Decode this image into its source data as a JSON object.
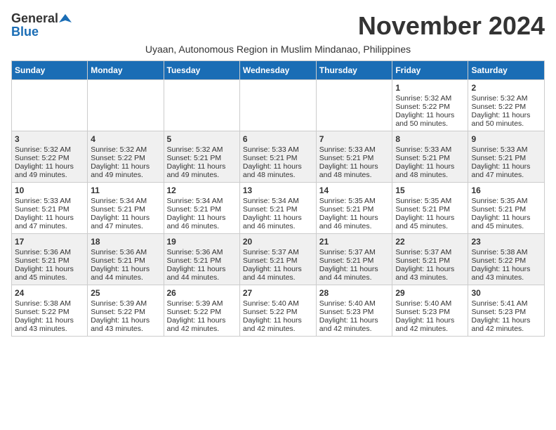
{
  "header": {
    "logo_general": "General",
    "logo_blue": "Blue",
    "month_title": "November 2024",
    "subtitle": "Uyaan, Autonomous Region in Muslim Mindanao, Philippines"
  },
  "weekdays": [
    "Sunday",
    "Monday",
    "Tuesday",
    "Wednesday",
    "Thursday",
    "Friday",
    "Saturday"
  ],
  "weeks": [
    [
      {
        "day": "",
        "sunrise": "",
        "sunset": "",
        "daylight": ""
      },
      {
        "day": "",
        "sunrise": "",
        "sunset": "",
        "daylight": ""
      },
      {
        "day": "",
        "sunrise": "",
        "sunset": "",
        "daylight": ""
      },
      {
        "day": "",
        "sunrise": "",
        "sunset": "",
        "daylight": ""
      },
      {
        "day": "",
        "sunrise": "",
        "sunset": "",
        "daylight": ""
      },
      {
        "day": "1",
        "sunrise": "Sunrise: 5:32 AM",
        "sunset": "Sunset: 5:22 PM",
        "daylight": "Daylight: 11 hours and 50 minutes."
      },
      {
        "day": "2",
        "sunrise": "Sunrise: 5:32 AM",
        "sunset": "Sunset: 5:22 PM",
        "daylight": "Daylight: 11 hours and 50 minutes."
      }
    ],
    [
      {
        "day": "3",
        "sunrise": "Sunrise: 5:32 AM",
        "sunset": "Sunset: 5:22 PM",
        "daylight": "Daylight: 11 hours and 49 minutes."
      },
      {
        "day": "4",
        "sunrise": "Sunrise: 5:32 AM",
        "sunset": "Sunset: 5:22 PM",
        "daylight": "Daylight: 11 hours and 49 minutes."
      },
      {
        "day": "5",
        "sunrise": "Sunrise: 5:32 AM",
        "sunset": "Sunset: 5:21 PM",
        "daylight": "Daylight: 11 hours and 49 minutes."
      },
      {
        "day": "6",
        "sunrise": "Sunrise: 5:33 AM",
        "sunset": "Sunset: 5:21 PM",
        "daylight": "Daylight: 11 hours and 48 minutes."
      },
      {
        "day": "7",
        "sunrise": "Sunrise: 5:33 AM",
        "sunset": "Sunset: 5:21 PM",
        "daylight": "Daylight: 11 hours and 48 minutes."
      },
      {
        "day": "8",
        "sunrise": "Sunrise: 5:33 AM",
        "sunset": "Sunset: 5:21 PM",
        "daylight": "Daylight: 11 hours and 48 minutes."
      },
      {
        "day": "9",
        "sunrise": "Sunrise: 5:33 AM",
        "sunset": "Sunset: 5:21 PM",
        "daylight": "Daylight: 11 hours and 47 minutes."
      }
    ],
    [
      {
        "day": "10",
        "sunrise": "Sunrise: 5:33 AM",
        "sunset": "Sunset: 5:21 PM",
        "daylight": "Daylight: 11 hours and 47 minutes."
      },
      {
        "day": "11",
        "sunrise": "Sunrise: 5:34 AM",
        "sunset": "Sunset: 5:21 PM",
        "daylight": "Daylight: 11 hours and 47 minutes."
      },
      {
        "day": "12",
        "sunrise": "Sunrise: 5:34 AM",
        "sunset": "Sunset: 5:21 PM",
        "daylight": "Daylight: 11 hours and 46 minutes."
      },
      {
        "day": "13",
        "sunrise": "Sunrise: 5:34 AM",
        "sunset": "Sunset: 5:21 PM",
        "daylight": "Daylight: 11 hours and 46 minutes."
      },
      {
        "day": "14",
        "sunrise": "Sunrise: 5:35 AM",
        "sunset": "Sunset: 5:21 PM",
        "daylight": "Daylight: 11 hours and 46 minutes."
      },
      {
        "day": "15",
        "sunrise": "Sunrise: 5:35 AM",
        "sunset": "Sunset: 5:21 PM",
        "daylight": "Daylight: 11 hours and 45 minutes."
      },
      {
        "day": "16",
        "sunrise": "Sunrise: 5:35 AM",
        "sunset": "Sunset: 5:21 PM",
        "daylight": "Daylight: 11 hours and 45 minutes."
      }
    ],
    [
      {
        "day": "17",
        "sunrise": "Sunrise: 5:36 AM",
        "sunset": "Sunset: 5:21 PM",
        "daylight": "Daylight: 11 hours and 45 minutes."
      },
      {
        "day": "18",
        "sunrise": "Sunrise: 5:36 AM",
        "sunset": "Sunset: 5:21 PM",
        "daylight": "Daylight: 11 hours and 44 minutes."
      },
      {
        "day": "19",
        "sunrise": "Sunrise: 5:36 AM",
        "sunset": "Sunset: 5:21 PM",
        "daylight": "Daylight: 11 hours and 44 minutes."
      },
      {
        "day": "20",
        "sunrise": "Sunrise: 5:37 AM",
        "sunset": "Sunset: 5:21 PM",
        "daylight": "Daylight: 11 hours and 44 minutes."
      },
      {
        "day": "21",
        "sunrise": "Sunrise: 5:37 AM",
        "sunset": "Sunset: 5:21 PM",
        "daylight": "Daylight: 11 hours and 44 minutes."
      },
      {
        "day": "22",
        "sunrise": "Sunrise: 5:37 AM",
        "sunset": "Sunset: 5:21 PM",
        "daylight": "Daylight: 11 hours and 43 minutes."
      },
      {
        "day": "23",
        "sunrise": "Sunrise: 5:38 AM",
        "sunset": "Sunset: 5:22 PM",
        "daylight": "Daylight: 11 hours and 43 minutes."
      }
    ],
    [
      {
        "day": "24",
        "sunrise": "Sunrise: 5:38 AM",
        "sunset": "Sunset: 5:22 PM",
        "daylight": "Daylight: 11 hours and 43 minutes."
      },
      {
        "day": "25",
        "sunrise": "Sunrise: 5:39 AM",
        "sunset": "Sunset: 5:22 PM",
        "daylight": "Daylight: 11 hours and 43 minutes."
      },
      {
        "day": "26",
        "sunrise": "Sunrise: 5:39 AM",
        "sunset": "Sunset: 5:22 PM",
        "daylight": "Daylight: 11 hours and 42 minutes."
      },
      {
        "day": "27",
        "sunrise": "Sunrise: 5:40 AM",
        "sunset": "Sunset: 5:22 PM",
        "daylight": "Daylight: 11 hours and 42 minutes."
      },
      {
        "day": "28",
        "sunrise": "Sunrise: 5:40 AM",
        "sunset": "Sunset: 5:23 PM",
        "daylight": "Daylight: 11 hours and 42 minutes."
      },
      {
        "day": "29",
        "sunrise": "Sunrise: 5:40 AM",
        "sunset": "Sunset: 5:23 PM",
        "daylight": "Daylight: 11 hours and 42 minutes."
      },
      {
        "day": "30",
        "sunrise": "Sunrise: 5:41 AM",
        "sunset": "Sunset: 5:23 PM",
        "daylight": "Daylight: 11 hours and 42 minutes."
      }
    ]
  ]
}
